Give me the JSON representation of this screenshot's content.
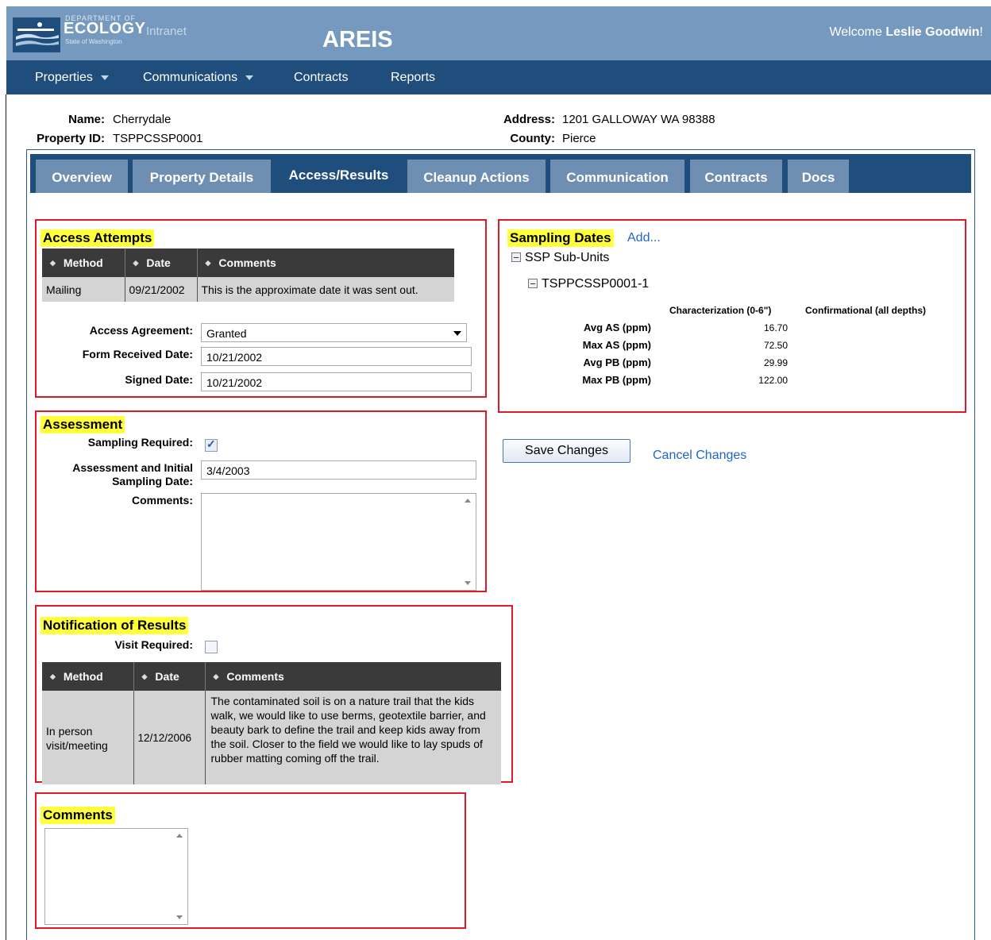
{
  "header": {
    "logo": {
      "dept": "DEPARTMENT OF",
      "name": "ECOLOGY",
      "suffix": "Intranet",
      "state": "State of Washington"
    },
    "app_title": "AREIS",
    "welcome_prefix": "Welcome ",
    "user_name": "Leslie Goodwin",
    "welcome_suffix": "!"
  },
  "nav": [
    {
      "label": "Properties",
      "has_dropdown": true
    },
    {
      "label": "Communications",
      "has_dropdown": true
    },
    {
      "label": "Contracts",
      "has_dropdown": false
    },
    {
      "label": "Reports",
      "has_dropdown": false
    }
  ],
  "property": {
    "name_label": "Name:",
    "name": "Cherrydale",
    "id_label": "Property ID:",
    "id": "TSPPCSSP0001",
    "address_label": "Address:",
    "address": "1201 GALLOWAY WA 98388",
    "county_label": "County:",
    "county": "Pierce"
  },
  "tabs": [
    {
      "label": "Overview",
      "active": false
    },
    {
      "label": "Property Details",
      "active": false
    },
    {
      "label": "Access/Results",
      "active": true
    },
    {
      "label": "Cleanup Actions",
      "active": false
    },
    {
      "label": "Communication",
      "active": false
    },
    {
      "label": "Contracts",
      "active": false
    },
    {
      "label": "Docs",
      "active": false
    }
  ],
  "access_attempts": {
    "title": "Access Attempts",
    "columns": [
      "Method",
      "Date",
      "Comments"
    ],
    "rows": [
      {
        "method": "Mailing",
        "date": "09/21/2002",
        "comments": "This is the approximate date it was sent out."
      }
    ],
    "agreement_label": "Access Agreement:",
    "agreement_value": "Granted",
    "form_received_label": "Form Received Date:",
    "form_received_value": "10/21/2002",
    "signed_label": "Signed Date:",
    "signed_value": "10/21/2002"
  },
  "assessment": {
    "title": "Assessment",
    "sampling_required_label": "Sampling Required:",
    "sampling_required": true,
    "date_label_1": "Assessment and Initial",
    "date_label_2": "Sampling Date:",
    "date_value": "3/4/2003",
    "comments_label": "Comments:"
  },
  "notification": {
    "title": "Notification of Results",
    "visit_required_label": "Visit Required:",
    "visit_required": false,
    "columns": [
      "Method",
      "Date",
      "Comments"
    ],
    "rows": [
      {
        "method": "In person visit/meeting",
        "date": "12/12/2006",
        "comments": "The contaminated soil is on a nature trail that the kids walk, we would like to use berms, geotextile barrier, and beauty bark to define the trail and keep kids away from the soil. Closer to the field we would like to lay spuds of rubber matting coming off the trail."
      }
    ]
  },
  "comments_section": {
    "title": "Comments"
  },
  "sampling": {
    "title": "Sampling Dates",
    "add_label": "Add...",
    "group_label": "SSP Sub-Units",
    "unit_label": "TSPPCSSP0001-1",
    "col_characterization": "Characterization (0-6\")",
    "col_confirmational": "Confirmational (all depths)",
    "stats": [
      {
        "label": "Avg AS (ppm)",
        "value": "16.70"
      },
      {
        "label": "Max AS (ppm)",
        "value": "72.50"
      },
      {
        "label": "Avg PB (ppm)",
        "value": "29.99"
      },
      {
        "label": "Max PB (ppm)",
        "value": "122.00"
      }
    ]
  },
  "actions": {
    "save_label": "Save Changes",
    "cancel_label": "Cancel Changes"
  }
}
